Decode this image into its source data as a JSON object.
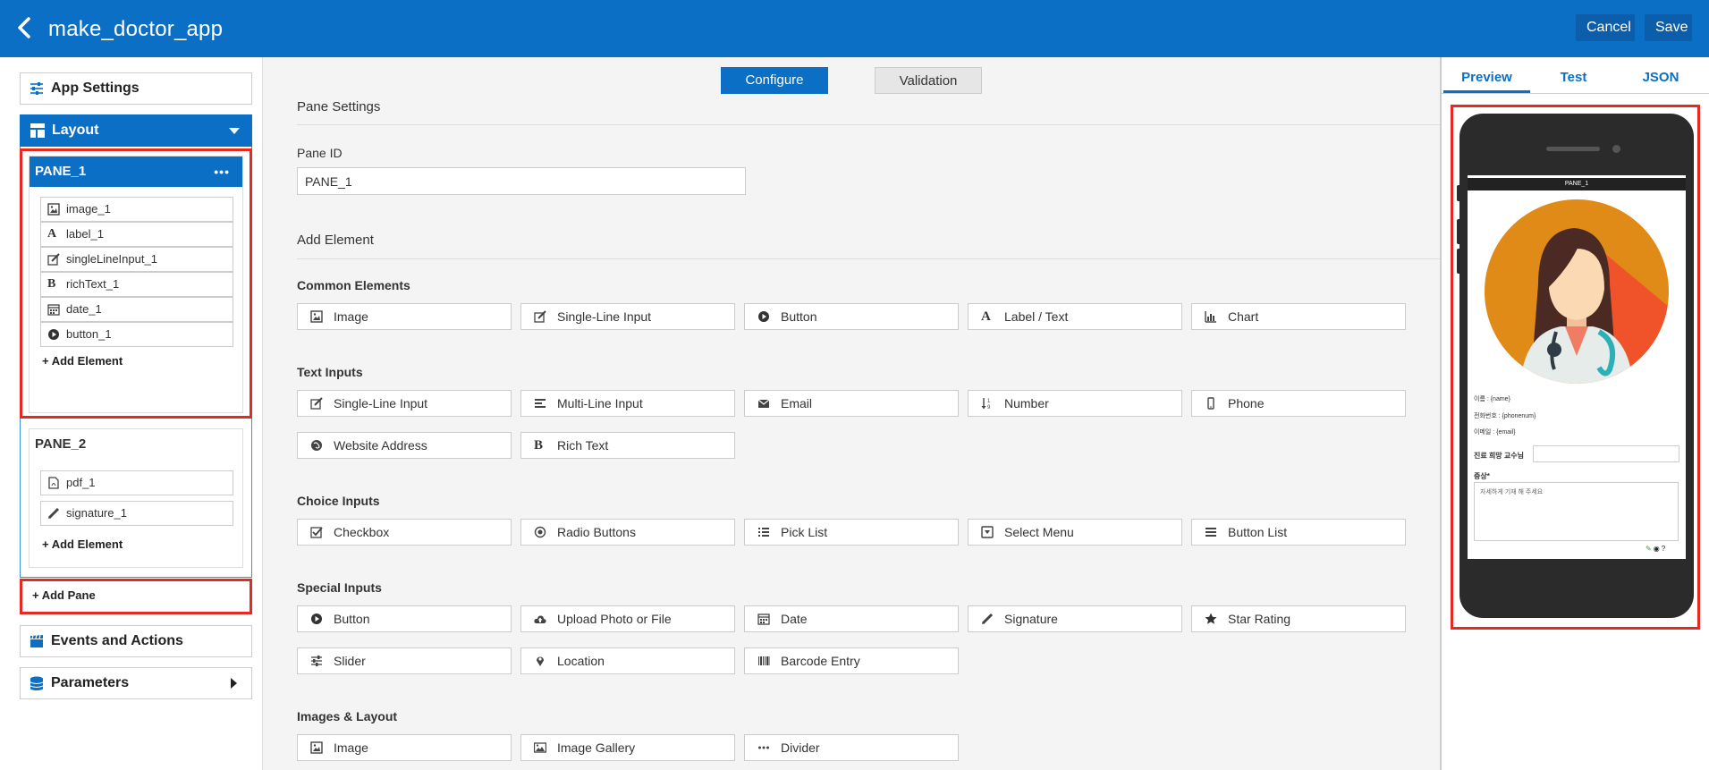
{
  "header": {
    "back_icon": "chevron-left-icon",
    "title": "make_doctor_app",
    "cancel_label": "Cancel",
    "save_label": "Save",
    "bg_color": "#0b6fc6"
  },
  "sidebar": {
    "app_settings": {
      "label": "App Settings",
      "icon": "sliders-icon"
    },
    "layout": {
      "label": "Layout",
      "icon": "layout-icon"
    },
    "panes": [
      {
        "name": "PANE_1",
        "menu": "•••",
        "elements": [
          {
            "label": "image_1",
            "icon": "image-icon"
          },
          {
            "label": "label_1",
            "icon": "font-icon"
          },
          {
            "label": "singleLineInput_1",
            "icon": "edit-icon"
          },
          {
            "label": "richText_1",
            "icon": "bold-icon"
          },
          {
            "label": "date_1",
            "icon": "calendar-icon"
          },
          {
            "label": "button_1",
            "icon": "play-circle-icon"
          }
        ],
        "add_element": "+ Add Element"
      },
      {
        "name": "PANE_2",
        "elements": [
          {
            "label": "pdf_1",
            "icon": "file-pdf-icon"
          },
          {
            "label": "signature_1",
            "icon": "pencil-icon"
          }
        ],
        "add_element": "+ Add Element"
      }
    ],
    "add_pane": "+ Add Pane",
    "events": {
      "label": "Events and Actions",
      "icon": "clapperboard-icon"
    },
    "parameters": {
      "label": "Parameters",
      "icon": "database-icon"
    }
  },
  "main": {
    "segments": {
      "configure": "Configure",
      "validation": "Validation"
    },
    "pane_settings": {
      "title": "Pane Settings",
      "pane_id_label": "Pane ID",
      "pane_id_value": "PANE_1"
    },
    "add_element_title": "Add Element",
    "groups": [
      {
        "title": "Common Elements",
        "items": [
          {
            "label": "Image",
            "icon": "image-icon"
          },
          {
            "label": "Single-Line Input",
            "icon": "edit-icon"
          },
          {
            "label": "Button",
            "icon": "play-circle-icon"
          },
          {
            "label": "Label / Text",
            "icon": "font-icon"
          },
          {
            "label": "Chart",
            "icon": "bar-chart-icon"
          }
        ]
      },
      {
        "title": "Text Inputs",
        "items": [
          {
            "label": "Single-Line Input",
            "icon": "edit-icon"
          },
          {
            "label": "Multi-Line Input",
            "icon": "align-left-icon"
          },
          {
            "label": "Email",
            "icon": "envelope-icon"
          },
          {
            "label": "Number",
            "icon": "sort-numeric-icon"
          },
          {
            "label": "Phone",
            "icon": "mobile-icon"
          },
          {
            "label": "Website Address",
            "icon": "globe-icon"
          },
          {
            "label": "Rich Text",
            "icon": "bold-icon"
          }
        ]
      },
      {
        "title": "Choice Inputs",
        "items": [
          {
            "label": "Checkbox",
            "icon": "checkbox-icon"
          },
          {
            "label": "Radio Buttons",
            "icon": "radio-icon"
          },
          {
            "label": "Pick List",
            "icon": "list-icon"
          },
          {
            "label": "Select Menu",
            "icon": "select-icon"
          },
          {
            "label": "Button List",
            "icon": "bars-icon"
          }
        ]
      },
      {
        "title": "Special Inputs",
        "items": [
          {
            "label": "Button",
            "icon": "play-circle-icon"
          },
          {
            "label": "Upload Photo or File",
            "icon": "cloud-upload-icon"
          },
          {
            "label": "Date",
            "icon": "calendar-icon"
          },
          {
            "label": "Signature",
            "icon": "pencil-icon"
          },
          {
            "label": "Star Rating",
            "icon": "star-icon"
          },
          {
            "label": "Slider",
            "icon": "sliders-icon"
          },
          {
            "label": "Location",
            "icon": "map-marker-icon"
          },
          {
            "label": "Barcode Entry",
            "icon": "barcode-icon"
          }
        ]
      },
      {
        "title": "Images & Layout",
        "items": [
          {
            "label": "Image",
            "icon": "image-icon"
          },
          {
            "label": "Image Gallery",
            "icon": "gallery-icon"
          },
          {
            "label": "Divider",
            "icon": "ellipsis-icon"
          }
        ]
      }
    ]
  },
  "right_panel": {
    "tabs": {
      "preview": "Preview",
      "test": "Test",
      "json": "JSON"
    },
    "phone": {
      "pane_title": "PANE_1",
      "name_line": "이름 : {name}",
      "phone_line": "전화번호 : {phonenum}",
      "email_line": "이메일 : {email}",
      "professor_label": "진료 희망 교수님",
      "symptom_label": "증상*",
      "symptom_placeholder": "자세하게 기재 해 주세요"
    }
  },
  "colors": {
    "highlight": "#e42a21",
    "accent": "#0b6fc6"
  }
}
